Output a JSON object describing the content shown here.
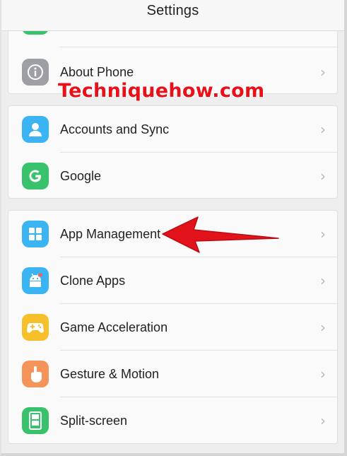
{
  "header": {
    "title": "Settings"
  },
  "watermark": "Techniquehow.com",
  "group1": {
    "items": [
      {
        "label": "",
        "icon": "partial-green-icon"
      },
      {
        "label": "About Phone",
        "icon": "info-icon"
      }
    ]
  },
  "group2": {
    "items": [
      {
        "label": "Accounts and Sync",
        "icon": "user-icon"
      },
      {
        "label": "Google",
        "icon": "google-g-icon"
      }
    ]
  },
  "group3": {
    "items": [
      {
        "label": "App Management",
        "icon": "app-grid-icon"
      },
      {
        "label": "Clone Apps",
        "icon": "clone-android-icon"
      },
      {
        "label": "Game Acceleration",
        "icon": "gamepad-icon"
      },
      {
        "label": "Gesture & Motion",
        "icon": "hand-icon"
      },
      {
        "label": "Split-screen",
        "icon": "split-screen-icon"
      }
    ]
  },
  "chevron": "›",
  "colors": {
    "grey_icon": "#9e9ea5",
    "blue_icon": "#3ab4f2",
    "green_icon": "#38c26c",
    "yellow_icon": "#f5c02a",
    "orange_icon": "#f4935a",
    "arrow_red": "#e3131b"
  }
}
